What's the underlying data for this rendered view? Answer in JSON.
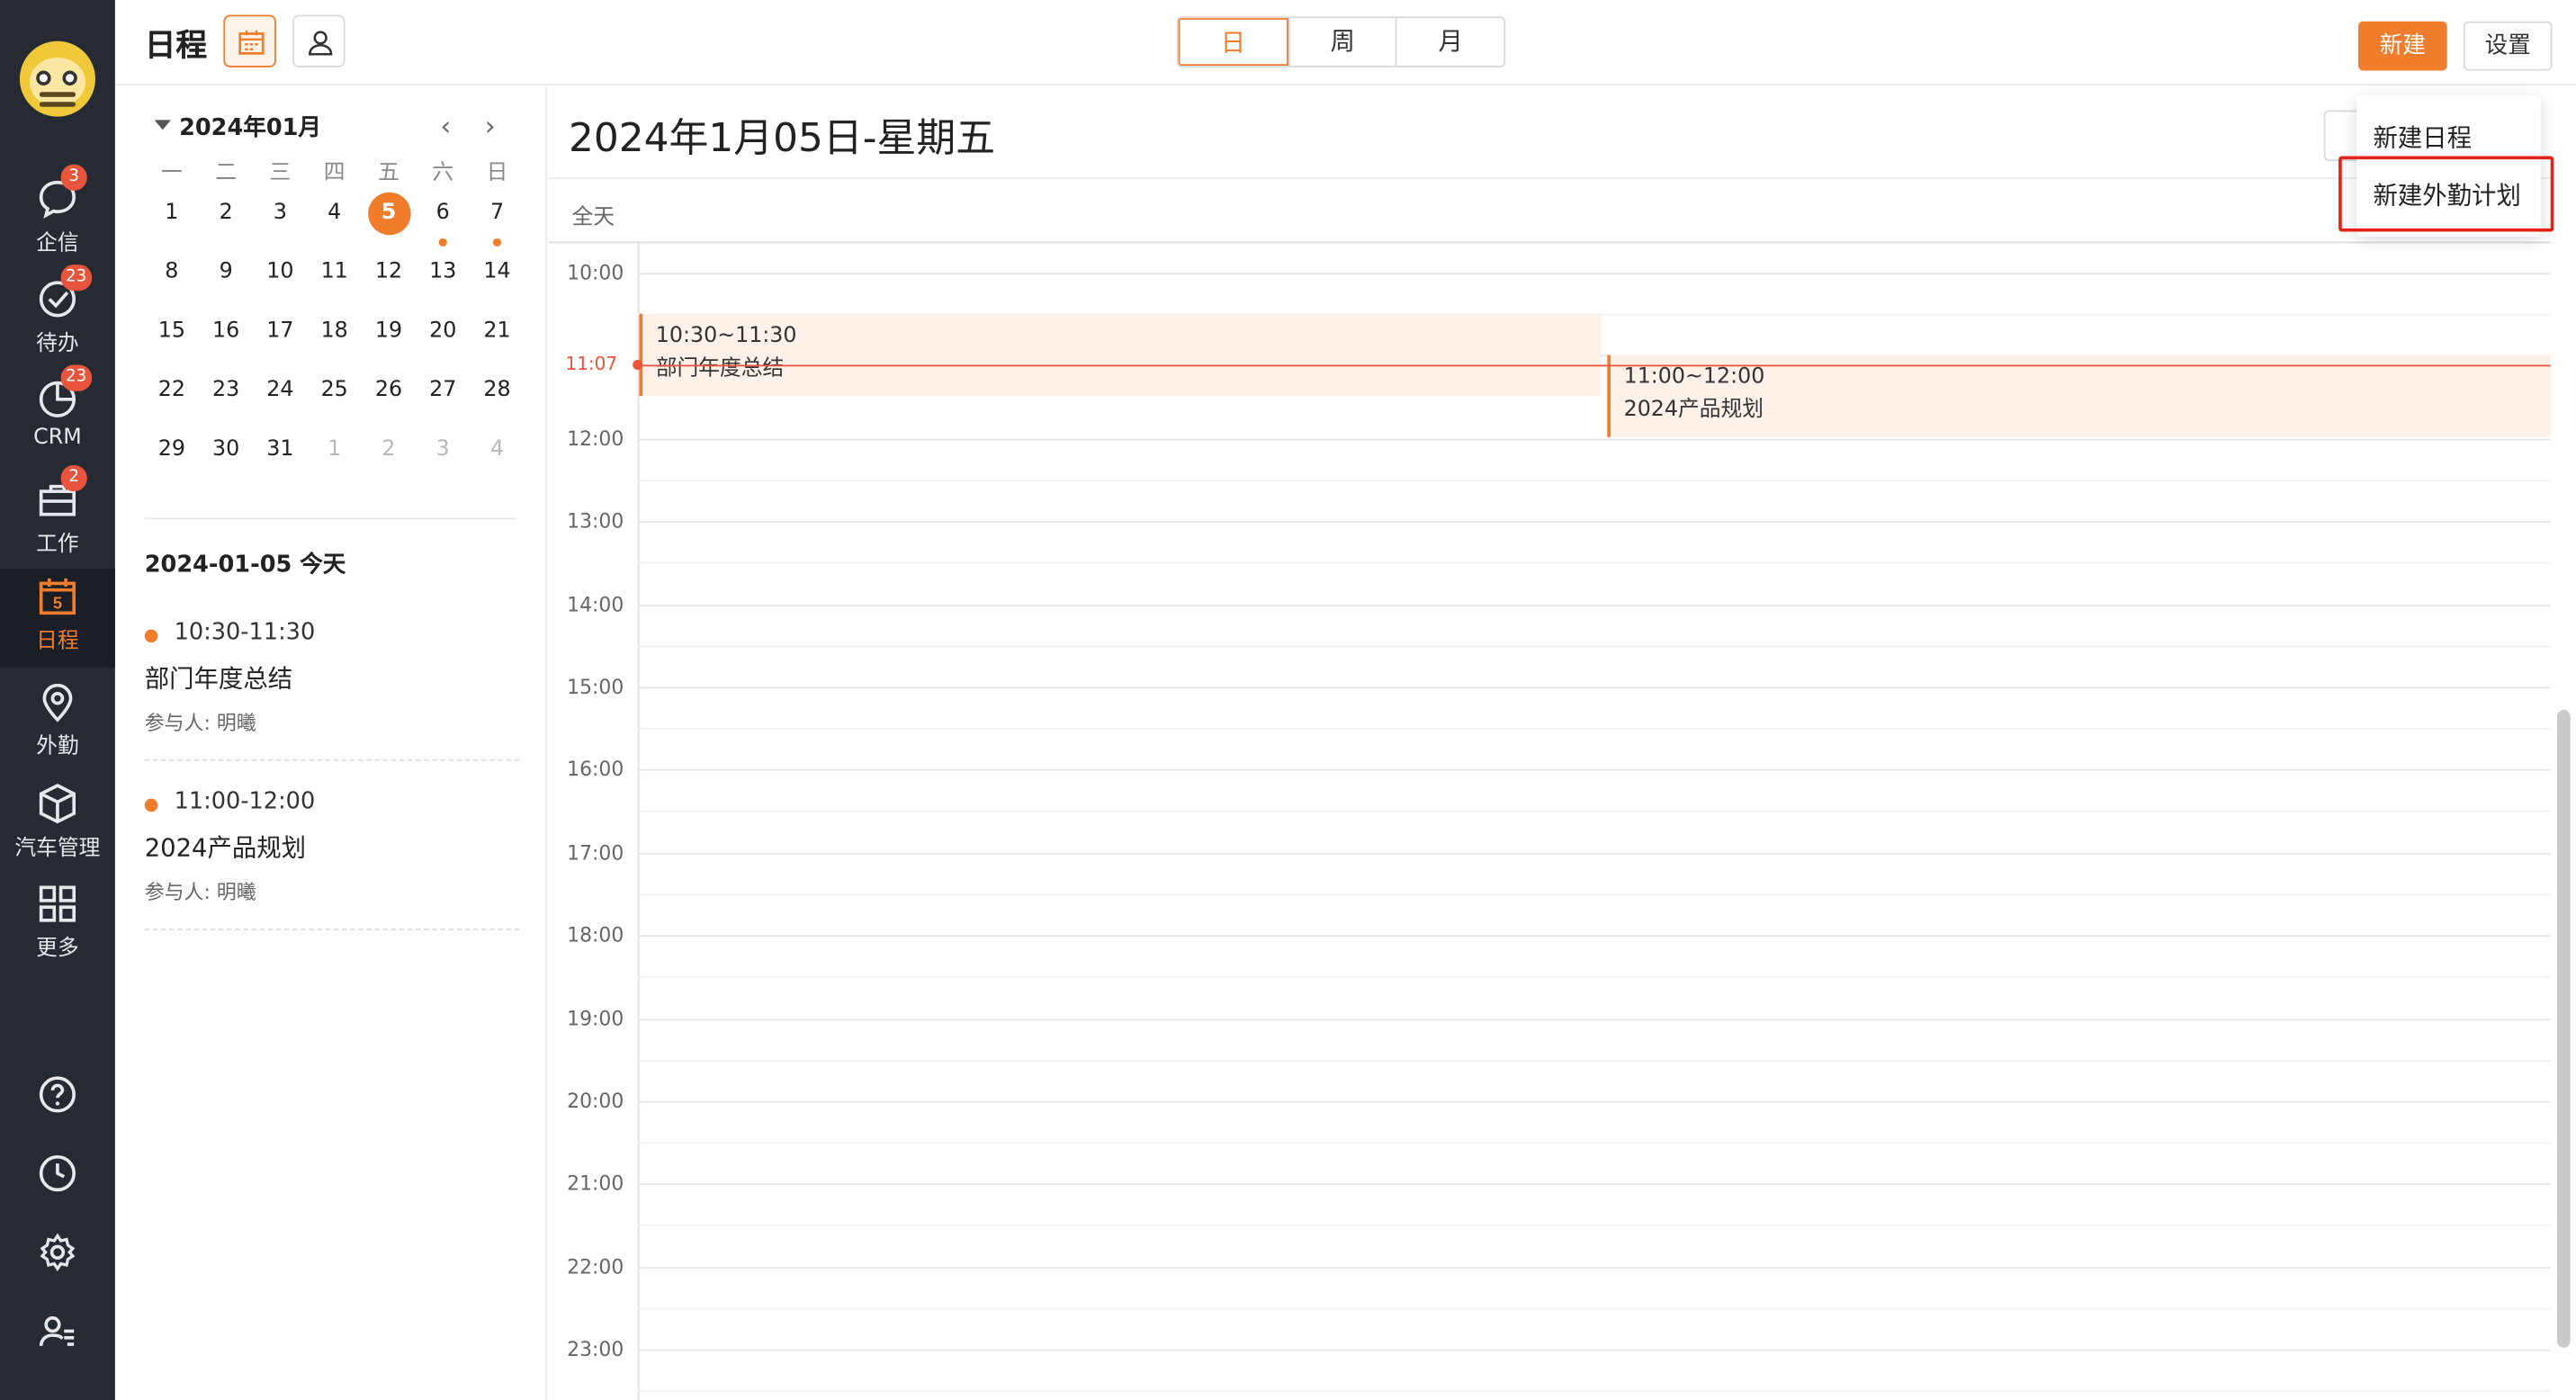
{
  "rail": {
    "items": [
      {
        "label": "企信",
        "badge": "3"
      },
      {
        "label": "待办",
        "badge": "23"
      },
      {
        "label": "CRM",
        "badge": "23"
      },
      {
        "label": "工作",
        "badge": "2"
      },
      {
        "label": "日程",
        "badge": "",
        "icon_text": "5"
      },
      {
        "label": "外勤",
        "badge": ""
      },
      {
        "label": "汽车管理",
        "badge": ""
      },
      {
        "label": "更多",
        "badge": ""
      }
    ],
    "bottom_icons": [
      "help-icon",
      "history-icon",
      "settings-icon",
      "user-list-icon"
    ]
  },
  "header": {
    "title": "日程",
    "view_tabs": [
      "日",
      "周",
      "月"
    ],
    "active_view": "日",
    "new_button": "新建",
    "settings_button": "设置"
  },
  "mini_calendar": {
    "month_label": "2024年01月",
    "weekdays": [
      "一",
      "二",
      "三",
      "四",
      "五",
      "六",
      "日"
    ],
    "weeks": [
      [
        "1",
        "2",
        "3",
        "4",
        "5",
        "6",
        "7"
      ],
      [
        "8",
        "9",
        "10",
        "11",
        "12",
        "13",
        "14"
      ],
      [
        "15",
        "16",
        "17",
        "18",
        "19",
        "20",
        "21"
      ],
      [
        "22",
        "23",
        "24",
        "25",
        "26",
        "27",
        "28"
      ],
      [
        "29",
        "30",
        "31",
        "1",
        "2",
        "3",
        "4"
      ]
    ],
    "today": "5",
    "dotted_days": [
      "6",
      "7"
    ]
  },
  "agenda": {
    "date_heading": "2024-01-05 今天",
    "items": [
      {
        "time": "10:30-11:30",
        "title": "部门年度总结",
        "people": "参与人: 明曦"
      },
      {
        "time": "11:00-12:00",
        "title": "2024产品规划",
        "people": "参与人: 明曦"
      }
    ]
  },
  "day_view": {
    "date_title": "2024年1月05日-星期五",
    "all_day_label": "全天",
    "hours": [
      "10:00",
      "12:00",
      "13:00",
      "14:00",
      "15:00",
      "16:00",
      "17:00",
      "18:00",
      "19:00",
      "20:00",
      "21:00",
      "22:00",
      "23:00"
    ],
    "now_label": "11:07",
    "events": [
      {
        "time": "10:30~11:30",
        "title": "部门年度总结"
      },
      {
        "time": "11:00~12:00",
        "title": "2024产品规划"
      }
    ]
  },
  "new_menu": {
    "items": [
      "新建日程",
      "新建外勤计划"
    ],
    "highlighted": "新建外勤计划"
  },
  "colors": {
    "accent": "#ef7d2b",
    "rail_bg": "#262b33",
    "badge": "#e8543c",
    "highlight_box": "#e2231a"
  }
}
